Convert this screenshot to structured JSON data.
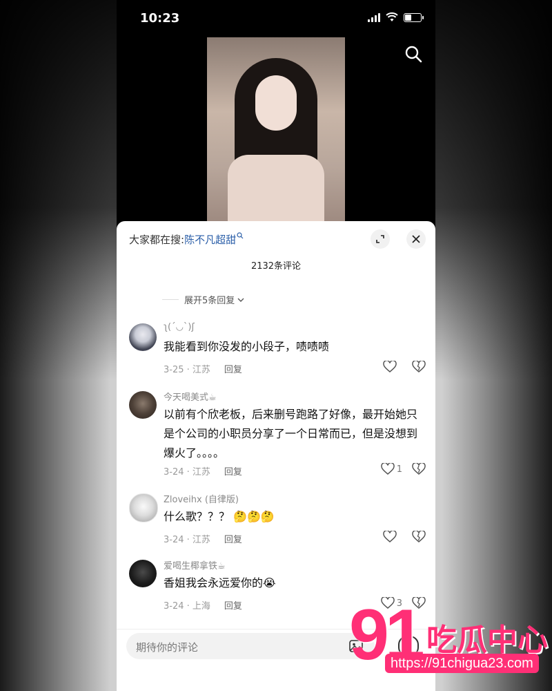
{
  "status_bar": {
    "time": "10:23"
  },
  "top": {
    "search_icon": "search-icon"
  },
  "sheet": {
    "search_prefix": "大家都在搜:",
    "search_keyword": "陈不凡超甜",
    "comment_count": "2132条评论",
    "expand_replies": "展开5条回复",
    "input_placeholder": "期待你的评论"
  },
  "comments": [
    {
      "name": "ʅ(´◡`)ʃ",
      "text": "我能看到你没发的小段子，啧啧啧",
      "date": "3-25 · 江苏",
      "reply": "回复",
      "likes": ""
    },
    {
      "name": "今天喝美式☕",
      "text": "以前有个欣老板，后来删号跑路了好像，最开始她只是个公司的小职员分享了一个日常而已，但是没想到爆火了。。。。",
      "date": "3-24 · 江苏",
      "reply": "回复",
      "likes": "1"
    },
    {
      "name": "Zloveihx (自律版)",
      "text": "什么歌？？？ 🤔🤔🤔",
      "date": "3-24 · 江苏",
      "reply": "回复",
      "likes": ""
    },
    {
      "name": "爱喝生椰拿铁☕",
      "text": "香姐我会永远爱你的😭",
      "date": "3-24 · 上海",
      "reply": "回复",
      "likes": "3"
    }
  ],
  "watermark": {
    "big": "91",
    "cn": "吃瓜中心",
    "url": "https://91chigua23.com"
  },
  "colors": {
    "accent_pink": "#ff2f76",
    "link_blue": "#2a5ea8"
  }
}
